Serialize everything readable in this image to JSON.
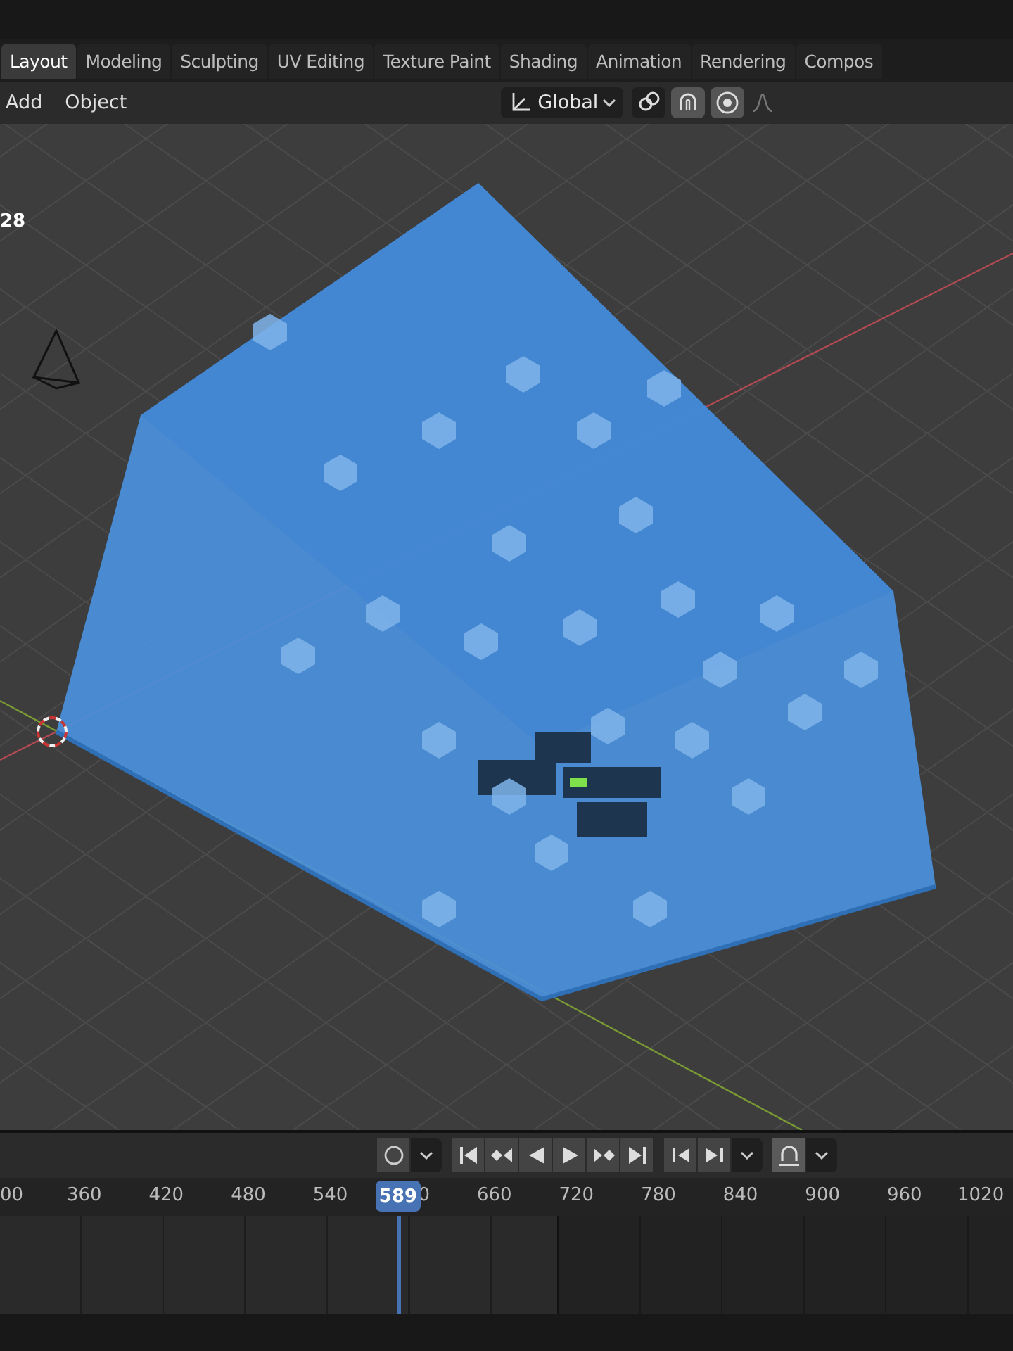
{
  "workspace_tabs": [
    {
      "label": "Layout",
      "selected": true
    },
    {
      "label": "Modeling",
      "selected": false
    },
    {
      "label": "Sculpting",
      "selected": false
    },
    {
      "label": "UV Editing",
      "selected": false
    },
    {
      "label": "Texture Paint",
      "selected": false
    },
    {
      "label": "Shading",
      "selected": false
    },
    {
      "label": "Animation",
      "selected": false
    },
    {
      "label": "Rendering",
      "selected": false
    },
    {
      "label": "Compos",
      "selected": false
    }
  ],
  "viewport_header": {
    "menus": [
      "Add",
      "Object"
    ],
    "orientation": "Global",
    "toggles": [
      {
        "kind": "pivot",
        "on": false
      },
      {
        "kind": "snap",
        "on": true
      },
      {
        "kind": "proportional",
        "on": true
      }
    ]
  },
  "viewport": {
    "overlay_text": "28"
  },
  "timeline": {
    "controls": [
      {
        "kind": "record",
        "on": false
      },
      {
        "kind": "jump-start",
        "on": false
      },
      {
        "kind": "prev-key",
        "on": false
      },
      {
        "kind": "play-back",
        "on": false
      },
      {
        "kind": "play",
        "on": false
      },
      {
        "kind": "next-key",
        "on": false
      },
      {
        "kind": "jump-end",
        "on": false
      },
      {
        "kind": "step-back",
        "on": false
      },
      {
        "kind": "step-forward",
        "on": false
      },
      {
        "kind": "snapping",
        "on": true
      }
    ],
    "ruler_labels": [
      "00",
      "360",
      "420",
      "480",
      "540",
      "0",
      "660",
      "720",
      "780",
      "840",
      "900",
      "960",
      "1020"
    ],
    "current_frame": "589"
  }
}
